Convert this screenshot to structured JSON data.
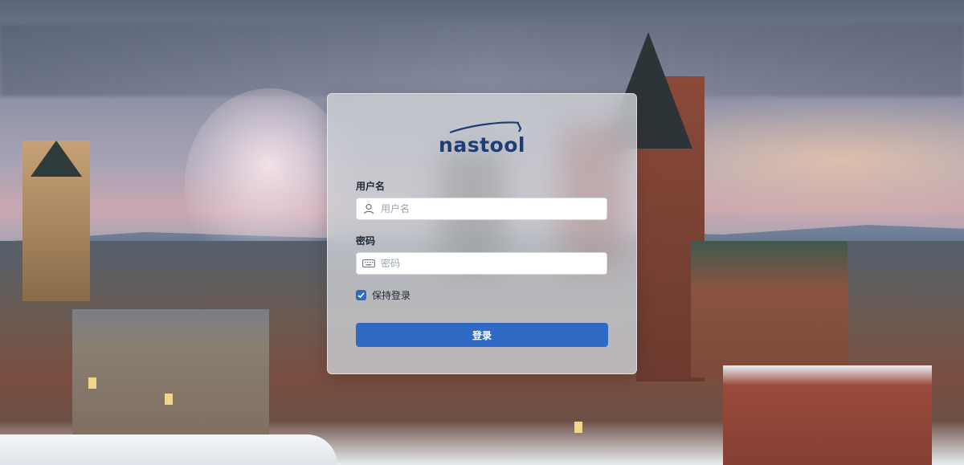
{
  "brand": {
    "logo_text": "nastool"
  },
  "form": {
    "username": {
      "label": "用户名",
      "placeholder": "用户名",
      "value": ""
    },
    "password": {
      "label": "密码",
      "placeholder": "密码",
      "value": ""
    },
    "remember": {
      "label": "保持登录",
      "checked": true
    },
    "submit_label": "登录"
  },
  "colors": {
    "primary": "#2f6bc4",
    "logo": "#1f3d75"
  },
  "icons": {
    "username_field": "user-icon",
    "password_field": "keyboard-icon",
    "remember": "checkmark-icon"
  }
}
